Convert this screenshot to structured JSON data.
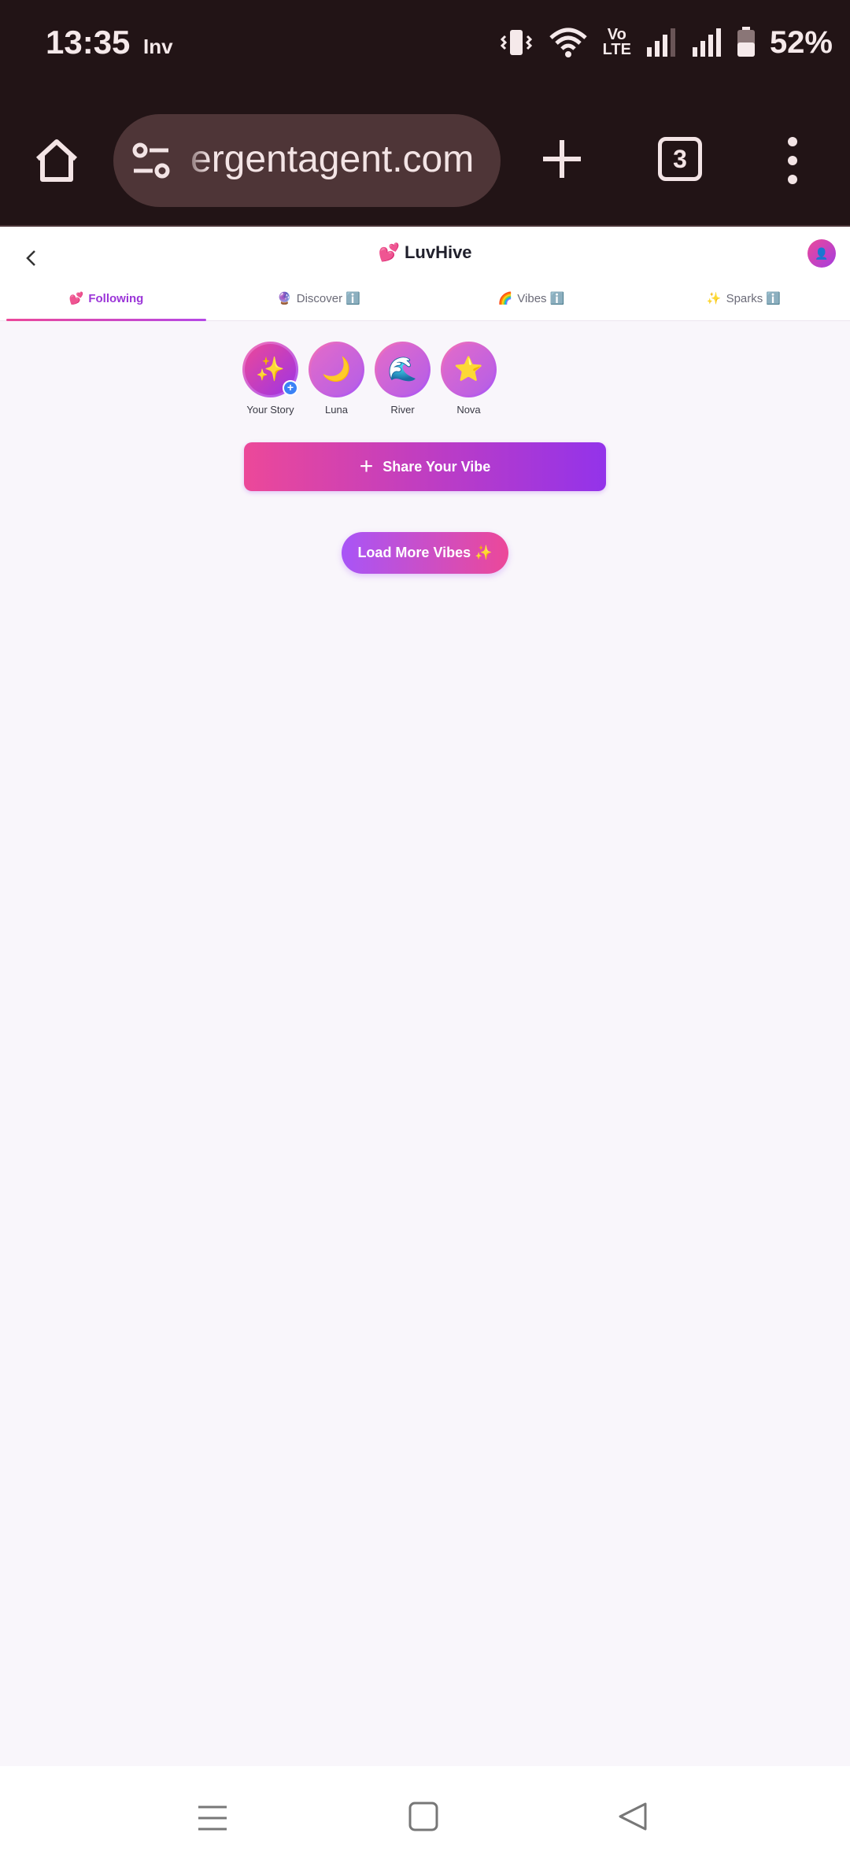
{
  "status_bar": {
    "time": "13:35",
    "carrier": "Inv",
    "volte_top": "Vo",
    "volte_bottom": "LTE",
    "battery": "52%"
  },
  "browser": {
    "url": "ergentagent.com",
    "tab_count": "3"
  },
  "app": {
    "title": "💕 LuvHive",
    "avatar_icon": "👤",
    "tabs": [
      {
        "icon": "💕",
        "label": "Following",
        "active": true
      },
      {
        "icon": "🔮",
        "label": "Discover ℹ️",
        "active": false
      },
      {
        "icon": "🌈",
        "label": "Vibes ℹ️",
        "active": false
      },
      {
        "icon": "✨",
        "label": "Sparks ℹ️",
        "active": false
      }
    ],
    "stories": [
      {
        "emoji": "✨",
        "label": "Your Story"
      },
      {
        "emoji": "🌙",
        "label": "Luna"
      },
      {
        "emoji": "🌊",
        "label": "River"
      },
      {
        "emoji": "⭐",
        "label": "Nova"
      }
    ],
    "story_plus": "+",
    "share_label": "Share Your Vibe",
    "load_more_label": "Load More Vibes ✨"
  },
  "colors": {
    "chrome_bg": "#221416",
    "accent_pink": "#ec4899",
    "accent_purple": "#9333ea"
  }
}
